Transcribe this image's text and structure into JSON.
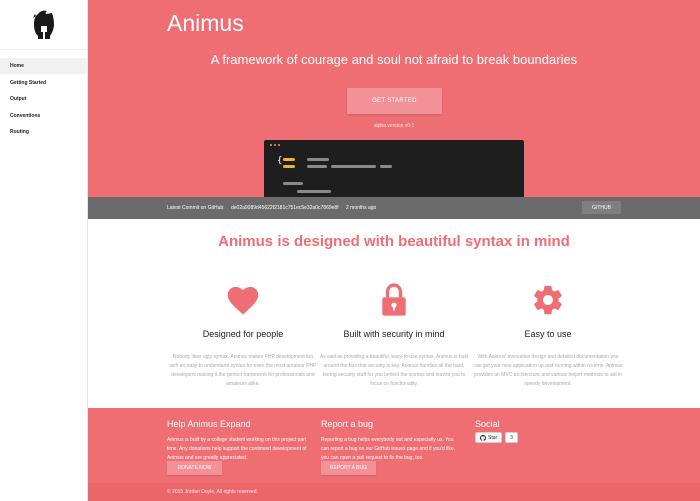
{
  "sidebar": {
    "logo": "spartan-helmet-icon",
    "items": [
      {
        "label": "Home",
        "active": true
      },
      {
        "label": "Getting Started",
        "active": false
      },
      {
        "label": "Output",
        "active": false
      },
      {
        "label": "Conventions",
        "active": false
      },
      {
        "label": "Routing",
        "active": false
      }
    ]
  },
  "hero": {
    "title": "Animus",
    "tagline": "A framework of courage and soul not afraid to break boundaries",
    "cta_label": "GET STARTED",
    "version": "alpha version v0.1"
  },
  "commit": {
    "label": "Latest Commit on GitHub:",
    "hash": "de02a9089d45622f2181c751ec5e32a0c7869e8f",
    "time": "2 months ago",
    "button_label": "GITHUB"
  },
  "features": {
    "heading": "Animus is designed with beautiful syntax in mind",
    "items": [
      {
        "icon": "heart-icon",
        "title": "Designed for people",
        "text": "Nobody likes ugly syntax. Animus makes PHP development fun with an easy to understand syntax for even the most amateur PHP developers making it the perfect framework for professionals and amateurs alike."
      },
      {
        "icon": "lock-icon",
        "title": "Built with security in mind",
        "text": "As well as providing a beautiful, easy-to-use syntax, Animus is built around the fact that security is key. Animus handles all the hard, boring security stuff for you behind the scenes and leaves you to focus on functionality."
      },
      {
        "icon": "gear-icon",
        "title": "Easy to use",
        "text": "With Animus' innovative design and detailed documentation you can get your new application up and running within no time. Animus provides an MVC architecture and various helper methods to aid in speedy development."
      }
    ]
  },
  "footer": {
    "help": {
      "title": "Help Animus Expand",
      "text": "Animus is built by a college student working on this project part time. Any donations help support the continued development of Animus and are greatly appreciated.",
      "button_label": "DONATE NOW"
    },
    "bug": {
      "title": "Report a bug",
      "text": "Reporting a bug helps everybody out and especially us. You can report a bug on our GitHub issues page and if you'd like, you can open a pull request to fix the bug, too.",
      "button_label": "REPORT A BUG"
    },
    "social": {
      "title": "Social",
      "star_label": "Star",
      "star_count": "3"
    },
    "copyright": "© 2015 Jordan Doyle, All rights reserved."
  },
  "colors": {
    "accent": "#ee6e73",
    "button": "#f39296",
    "commit_bar": "#6b6b6b",
    "code_bg": "#1e1e1e",
    "code_accent": "#f0b429",
    "code_muted": "#8a8a8a"
  }
}
